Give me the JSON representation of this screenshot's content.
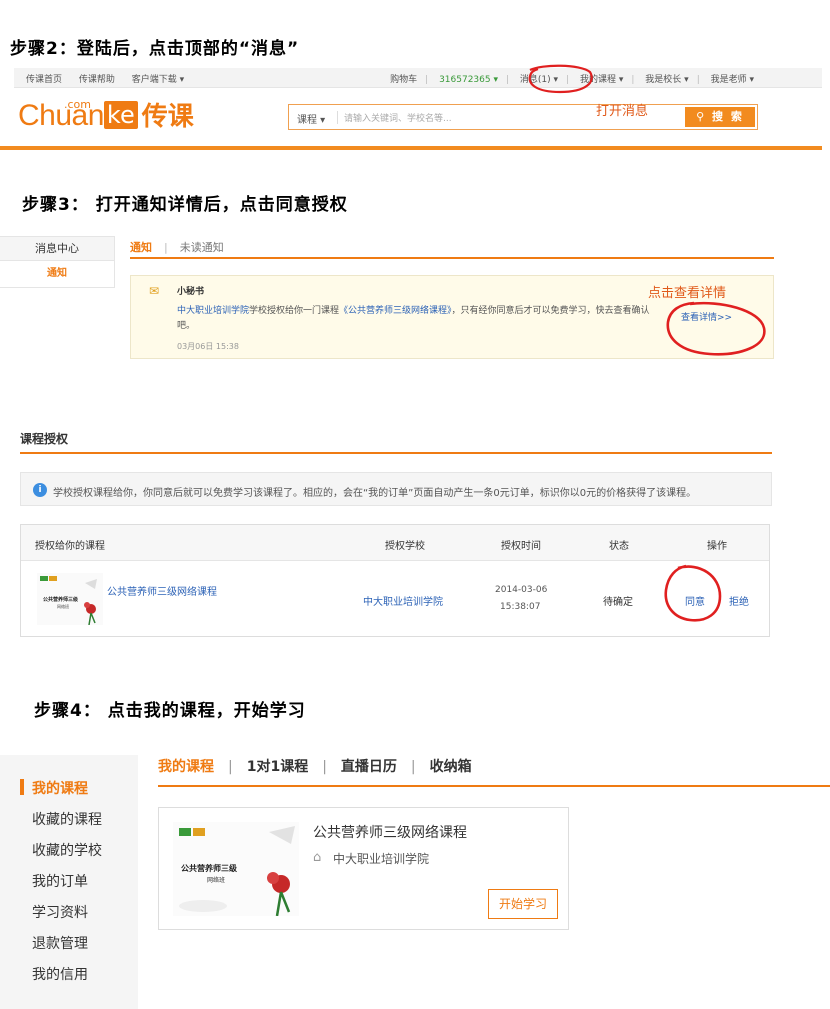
{
  "step2": {
    "title": "步骤2：登陆后，点击顶部的“消息”",
    "nav_left": [
      "传课首页",
      "传课帮助",
      "客户端下载 ▾"
    ],
    "nav_right": {
      "cart": "购物车",
      "user_id": "316572365 ▾",
      "messages": "消息(1) ▾",
      "my_courses": "我的课程 ▾",
      "principal": "我是校长 ▾",
      "teacher": "我是老师 ▾"
    },
    "logo": {
      "dotcom": ".com",
      "chuan": "Chuan",
      "ke": "ke",
      "cn": "传课"
    },
    "search": {
      "category": "课程 ▾",
      "placeholder": "请输入关键词、学校名等...",
      "button": "搜 索"
    },
    "annotation": "打开消息"
  },
  "step3": {
    "title": "步骤3： 打开通知详情后，点击同意授权",
    "sidebar_header": "消息中心",
    "sidebar_item": "通知",
    "tabs": {
      "active": "通知",
      "inactive": "未读通知"
    },
    "notice": {
      "from": "小秘书",
      "school_link": "中大职业培训学院",
      "text_a": "学校授权给你一门课程",
      "course_link": "《公共营养师三级网络课程》",
      "text_b": "，只有经你同意后才可以免费学习，快去查看确认吧。",
      "time": "03月06日 15:38",
      "more": "查看详情>>"
    },
    "annotation": "点击查看详情"
  },
  "auth": {
    "title": "课程授权",
    "tip": "学校授权课程给你，你同意后就可以免费学习该课程了。相应的，会在“我的订单”页面自动产生一条0元订单，标识你以0元的价格获得了该课程。",
    "columns": [
      "授权给你的课程",
      "授权学校",
      "授权时间",
      "状态",
      "操作"
    ],
    "row": {
      "course": "公共营养师三级网络课程",
      "school": "中大职业培训学院",
      "date": "2014-03-06",
      "time": "15:38:07",
      "status": "待确定",
      "agree": "同意",
      "reject": "拒绝"
    }
  },
  "step4": {
    "title": "步骤4： 点击我的课程，开始学习",
    "sidebar": [
      "我的课程",
      "收藏的课程",
      "收藏的学校",
      "我的订单",
      "学习资料",
      "退款管理",
      "我的信用"
    ],
    "tabs": [
      "我的课程",
      "1对1课程",
      "直播日历",
      "收纳箱"
    ],
    "card": {
      "title": "公共营养师三级网络课程",
      "school": "中大职业培训学院",
      "button": "开始学习",
      "thumb_title": "公共营养师三级",
      "thumb_sub": "网络班"
    }
  },
  "colors": {
    "accent": "#ef7b13",
    "link": "#2c62b6",
    "annotation": "#e02020"
  }
}
